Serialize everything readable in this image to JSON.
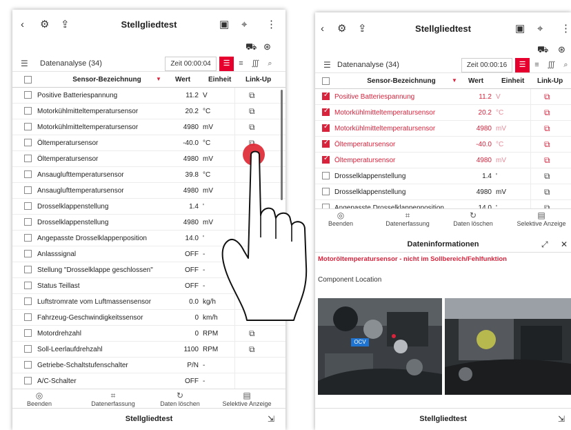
{
  "left": {
    "header": {
      "title": "Stellgliedtest"
    },
    "data_analysis": {
      "label": "Datenanalyse (34)",
      "time": "Zeit 00:00:04"
    },
    "columns": {
      "sensor": "Sensor-Bezeichnung",
      "wert": "Wert",
      "einheit": "Einheit",
      "linkup": "Link-Up"
    },
    "rows": [
      {
        "name": "Positive Batteriespannung",
        "value": "11.2",
        "unit": "V",
        "link": true
      },
      {
        "name": "Motorkühlmitteltemperatursensor",
        "value": "20.2",
        "unit": "°C",
        "link": true
      },
      {
        "name": "Motorkühlmitteltemperatursensor",
        "value": "4980",
        "unit": "mV",
        "link": true
      },
      {
        "name": "Öltemperatursensor",
        "value": "-40.0",
        "unit": "°C",
        "link": true
      },
      {
        "name": "Öltemperatursensor",
        "value": "4980",
        "unit": "mV",
        "link": true
      },
      {
        "name": "Ansauglufttemperatursensor",
        "value": "39.8",
        "unit": "°C",
        "link": false
      },
      {
        "name": "Ansauglufttemperatursensor",
        "value": "4980",
        "unit": "mV",
        "link": false
      },
      {
        "name": "Drosselklappenstellung",
        "value": "1.4",
        "unit": "'",
        "link": false
      },
      {
        "name": "Drosselklappenstellung",
        "value": "4980",
        "unit": "mV",
        "link": false
      },
      {
        "name": "Angepasste Drosselklappenposition",
        "value": "14.0",
        "unit": "'",
        "link": false
      },
      {
        "name": "Anlasssignal",
        "value": "OFF",
        "unit": "-",
        "link": false
      },
      {
        "name": "Stellung \"Drosselklappe geschlossen\"",
        "value": "OFF",
        "unit": "-",
        "link": false
      },
      {
        "name": "Status Teillast",
        "value": "OFF",
        "unit": "-",
        "link": false
      },
      {
        "name": "Luftstromrate vom Luftmassensensor",
        "value": "0.0",
        "unit": "kg/h",
        "link": false
      },
      {
        "name": "Fahrzeug-Geschwindigkeitssensor",
        "value": "0",
        "unit": "km/h",
        "link": true
      },
      {
        "name": "Motordrehzahl",
        "value": "0",
        "unit": "RPM",
        "link": true
      },
      {
        "name": "Soll-Leerlaufdrehzahl",
        "value": "1100",
        "unit": "RPM",
        "link": true
      },
      {
        "name": "Getriebe-Schaltstufenschalter",
        "value": "P/N",
        "unit": "-",
        "link": false
      },
      {
        "name": "A/C-Schalter",
        "value": "OFF",
        "unit": "-",
        "link": false
      }
    ],
    "tools": {
      "beenden": "Beenden",
      "datenerfassung": "Datenerfassung",
      "daten_loeschen": "Daten löschen",
      "selektive": "Selektive Anzeige"
    },
    "footer_title": "Stellgliedtest"
  },
  "right": {
    "header": {
      "title": "Stellgliedtest"
    },
    "data_analysis": {
      "label": "Datenanalyse (34)",
      "time": "Zeit 00:00:16"
    },
    "columns": {
      "sensor": "Sensor-Bezeichnung",
      "wert": "Wert",
      "einheit": "Einheit",
      "linkup": "Link-Up"
    },
    "rows": [
      {
        "name": "Positive Batteriespannung",
        "value": "11.2",
        "unit": "V",
        "checked": true
      },
      {
        "name": "Motorkühlmitteltemperatursensor",
        "value": "20.2",
        "unit": "°C",
        "checked": true
      },
      {
        "name": "Motorkühlmitteltemperatursensor",
        "value": "4980",
        "unit": "mV",
        "checked": true
      },
      {
        "name": "Öltemperatursensor",
        "value": "-40.0",
        "unit": "°C",
        "checked": true
      },
      {
        "name": "Öltemperatursensor",
        "value": "4980",
        "unit": "mV",
        "checked": true
      },
      {
        "name": "Drosselklappenstellung",
        "value": "1.4",
        "unit": "'",
        "checked": false
      },
      {
        "name": "Drosselklappenstellung",
        "value": "4980",
        "unit": "mV",
        "checked": false
      },
      {
        "name": "Angepasste Drosselklappenposition",
        "value": "14.0",
        "unit": "'",
        "checked": false
      }
    ],
    "tools": {
      "beenden": "Beenden",
      "datenerfassung": "Datenerfassung",
      "daten_loeschen": "Daten löschen",
      "selektive": "Selektive Anzeige"
    },
    "info": {
      "title": "Dateninformationen",
      "fault": "Motoröltemperatursensor - nicht im Sollbereich/Fehlfunktion",
      "component_location": "Component Location",
      "photo_tag": "OCV"
    },
    "footer_title": "Stellgliedtest"
  },
  "colors": {
    "accent": "#d8233c",
    "tap": "#e02935"
  },
  "icons": {
    "back": "chevron-left-icon",
    "menu": "kebab-icon",
    "link": "link-up-icon"
  }
}
